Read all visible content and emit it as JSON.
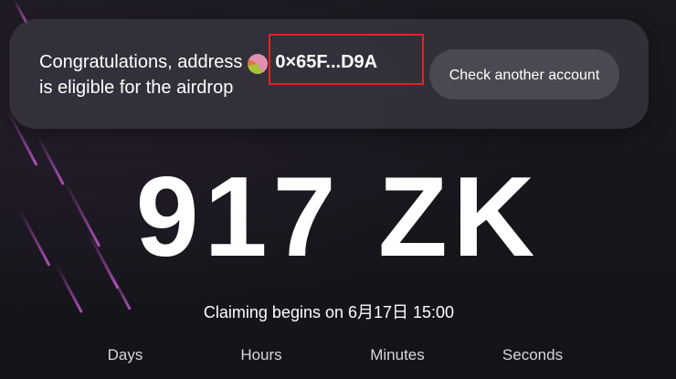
{
  "banner": {
    "line1_prefix": "Congratulations, address",
    "address": "0×65F...D9A",
    "line2": "is eligible for the airdrop",
    "check_button_label": "Check another account"
  },
  "amount": {
    "value": "917 ZK"
  },
  "claim": {
    "text": "Claiming begins on 6月17日 15:00"
  },
  "countdown": {
    "days_label": "Days",
    "hours_label": "Hours",
    "minutes_label": "Minutes",
    "seconds_label": "Seconds"
  },
  "colors": {
    "background": "#17161b",
    "banner": "#3a3942",
    "button": "#4a4951",
    "highlight": "#e52222",
    "streak": "#c85ad2"
  },
  "icons": {
    "avatar": "wallet-avatar-icon"
  }
}
